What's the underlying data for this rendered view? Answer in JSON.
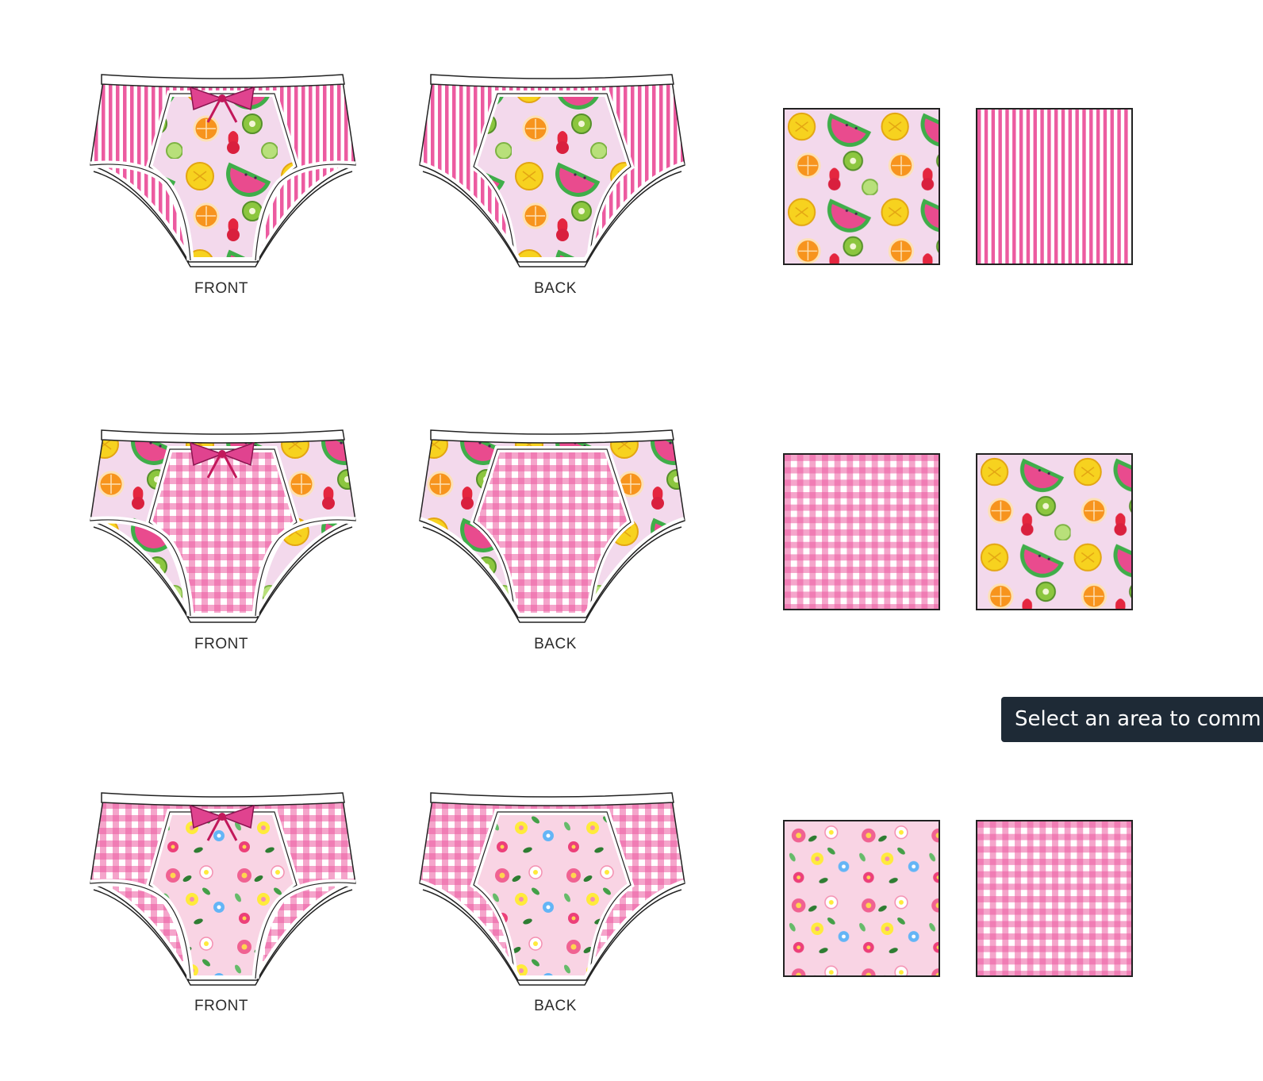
{
  "colors": {
    "pink": "#ec5ba0",
    "light_pink": "#f7c3dc",
    "lilac": "#f3d9ec",
    "tooltip_bg": "#1e2a36"
  },
  "rows": [
    {
      "front_label": "FRONT",
      "back_label": "BACK",
      "front": {
        "center": "fruit",
        "side": "stripes"
      },
      "back": {
        "center": "fruit",
        "side": "stripes"
      },
      "swatches": [
        "fruit",
        "stripes"
      ]
    },
    {
      "front_label": "FRONT",
      "back_label": "BACK",
      "front": {
        "center": "gingham",
        "side": "fruit"
      },
      "back": {
        "center": "gingham",
        "side": "fruit"
      },
      "swatches": [
        "gingham",
        "fruit"
      ]
    },
    {
      "front_label": "FRONT",
      "back_label": "BACK",
      "front": {
        "center": "floral",
        "side": "gingham"
      },
      "back": {
        "center": "floral",
        "side": "gingham"
      },
      "swatches": [
        "floral",
        "gingham"
      ]
    }
  ],
  "tooltip": {
    "text": "Select an area to comm"
  }
}
